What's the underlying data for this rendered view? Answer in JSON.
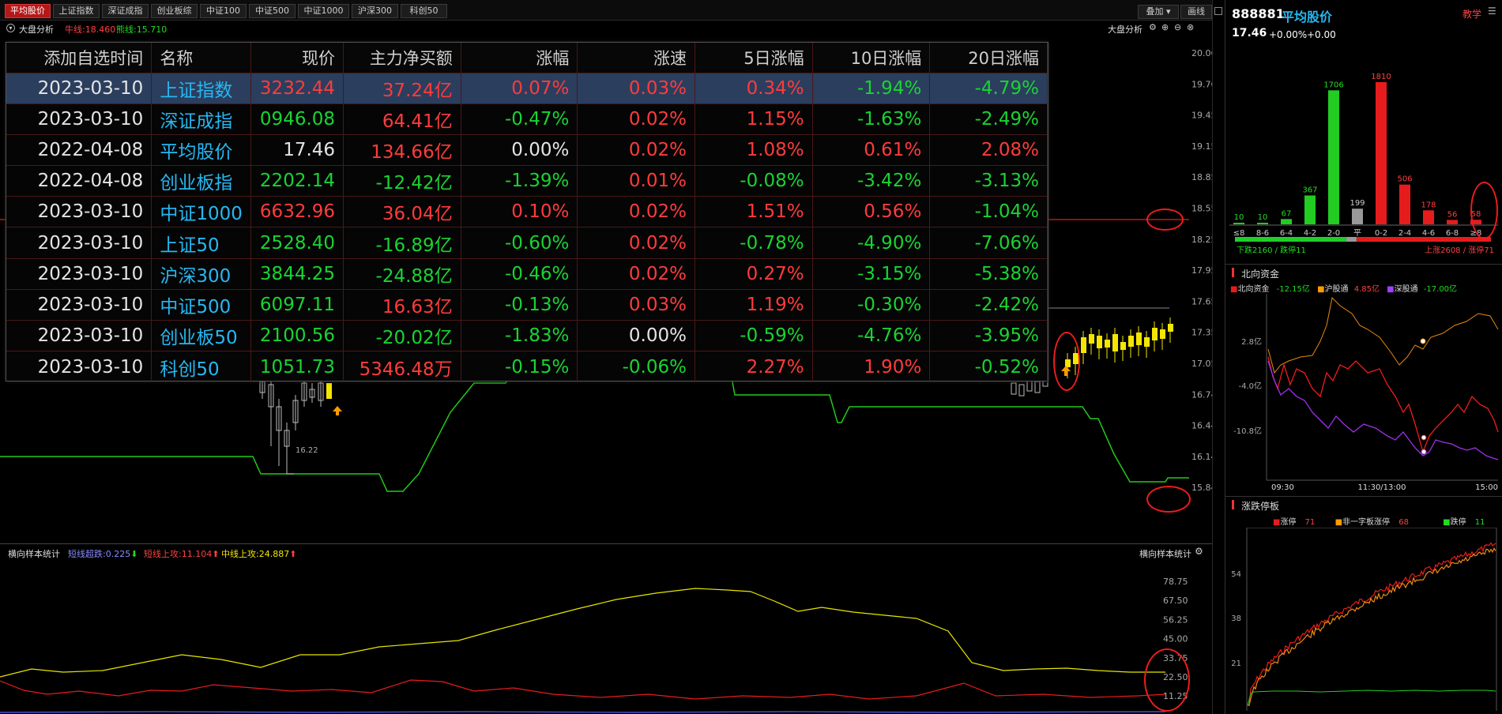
{
  "tabs": [
    {
      "label": "平均股价",
      "active": true
    },
    {
      "label": "上证指数"
    },
    {
      "label": "深证成指"
    },
    {
      "label": "创业板综"
    },
    {
      "label": "中证100"
    },
    {
      "label": "中证500"
    },
    {
      "label": "中证1000"
    },
    {
      "label": "沪深300"
    },
    {
      "label": "科创50"
    }
  ],
  "toolbar": {
    "overlay": "叠加",
    "draw": "画线"
  },
  "subheader": {
    "analysis": "大盘分析",
    "niu_label": "牛线:18.460",
    "xiong_label": "熊线:15.710",
    "right_label": "大盘分析"
  },
  "watchlist": {
    "headers": [
      "添加自选时间",
      "名称",
      "现价",
      "主力净买额",
      "涨幅",
      "涨速",
      "5日涨幅",
      "10日涨幅",
      "20日涨幅"
    ],
    "rows": [
      {
        "date": "2023-03-10",
        "name": "上证指数",
        "price": "3232.44",
        "net": "37.24亿",
        "chg": "0.07%",
        "speed": "0.03%",
        "d5": "0.34%",
        "d10": "-1.94%",
        "d20": "-4.79%"
      },
      {
        "date": "2023-03-10",
        "name": "深证成指",
        "price": "0946.08",
        "net": "64.41亿",
        "chg": "-0.47%",
        "speed": "0.02%",
        "d5": "1.15%",
        "d10": "-1.63%",
        "d20": "-2.49%"
      },
      {
        "date": "2022-04-08",
        "name": "平均股价",
        "price": "17.46",
        "net": "134.66亿",
        "chg": "0.00%",
        "speed": "0.02%",
        "d5": "1.08%",
        "d10": "0.61%",
        "d20": "2.08%"
      },
      {
        "date": "2022-04-08",
        "name": "创业板指",
        "price": "2202.14",
        "net": "-12.42亿",
        "chg": "-1.39%",
        "speed": "0.01%",
        "d5": "-0.08%",
        "d10": "-3.42%",
        "d20": "-3.13%"
      },
      {
        "date": "2023-03-10",
        "name": "中证1000",
        "price": "6632.96",
        "net": "36.04亿",
        "chg": "0.10%",
        "speed": "0.02%",
        "d5": "1.51%",
        "d10": "0.56%",
        "d20": "-1.04%"
      },
      {
        "date": "2023-03-10",
        "name": "上证50",
        "price": "2528.40",
        "net": "-16.89亿",
        "chg": "-0.60%",
        "speed": "0.02%",
        "d5": "-0.78%",
        "d10": "-4.90%",
        "d20": "-7.06%"
      },
      {
        "date": "2023-03-10",
        "name": "沪深300",
        "price": "3844.25",
        "net": "-24.88亿",
        "chg": "-0.46%",
        "speed": "0.02%",
        "d5": "0.27%",
        "d10": "-3.15%",
        "d20": "-5.38%"
      },
      {
        "date": "2023-03-10",
        "name": "中证500",
        "price": "6097.11",
        "net": "16.63亿",
        "chg": "-0.13%",
        "speed": "0.03%",
        "d5": "1.19%",
        "d10": "-0.30%",
        "d20": "-2.42%"
      },
      {
        "date": "2023-03-10",
        "name": "创业板50",
        "price": "2100.56",
        "net": "-20.02亿",
        "chg": "-1.83%",
        "speed": "0.00%",
        "d5": "-0.59%",
        "d10": "-4.76%",
        "d20": "-3.95%"
      },
      {
        "date": "2023-03-10",
        "name": "科创50",
        "price": "1051.73",
        "net": "5346.48万",
        "chg": "-0.15%",
        "speed": "-0.06%",
        "d5": "2.27%",
        "d10": "1.90%",
        "d20": "-0.52%"
      }
    ]
  },
  "main_chart": {
    "y_ticks": [
      "20.06",
      "19.76",
      "19.45",
      "19.15",
      "18.85",
      "18.55",
      "18.25",
      "17.95",
      "17.65",
      "17.35",
      "17.05",
      "16.74",
      "16.44",
      "16.14",
      "15.84"
    ],
    "low_label": "16.22"
  },
  "lower_panel": {
    "title": "横向样本统计",
    "short_down": "短线超跌:0.225",
    "short_up": "短线上攻:11.104",
    "mid_up": "中线上攻:24.887",
    "right_title": "横向样本统计",
    "y_ticks": [
      "78.75",
      "67.50",
      "56.25",
      "45.00",
      "33.75",
      "22.50",
      "11.25"
    ]
  },
  "right_panel": {
    "code": "888881",
    "name": "平均股价",
    "teach": "教学",
    "price": "17.46",
    "chg_pct": "+0.00%",
    "chg": "+0.00",
    "dist_values": [
      "10",
      "10",
      "67",
      "367",
      "1706",
      "199",
      "1810",
      "506",
      "178",
      "56",
      "58"
    ],
    "dist_labels": [
      "≤8",
      "8-6",
      "6-4",
      "4-2",
      "2-0",
      "平",
      "0-2",
      "2-4",
      "4-6",
      "6-8",
      "≥8"
    ],
    "down_text": "下跌2160 / 跌停11",
    "up_text": "上涨2608 / 涨停71",
    "north": {
      "title": "北向资金",
      "l1": "北向资金",
      "v1": "-12.15亿",
      "l2": "沪股通",
      "v2": "4.85亿",
      "l3": "深股通",
      "v3": "-17.00亿",
      "y_ticks": [
        "2.8亿",
        "-4.0亿",
        "-10.8亿"
      ],
      "x_ticks": [
        "09:30",
        "11:30/13:00",
        "15:00"
      ]
    },
    "limit": {
      "title": "涨跌停板",
      "l1": "涨停",
      "v1": "71",
      "l2": "非一字板涨停",
      "v2": "68",
      "l3": "跌停",
      "v3": "11",
      "y_ticks": [
        "54",
        "38",
        "21"
      ]
    }
  }
}
